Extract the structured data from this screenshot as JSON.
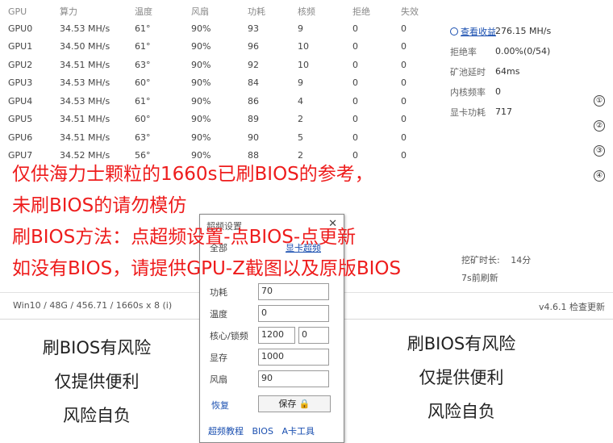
{
  "table": {
    "headers": [
      "GPU",
      "算力",
      "温度",
      "风扇",
      "功耗",
      "核频",
      "拒绝",
      "失效"
    ],
    "rows": [
      [
        "GPU0",
        "34.53 MH/s",
        "61°",
        "90%",
        "93",
        "9",
        "0",
        "0"
      ],
      [
        "GPU1",
        "34.50 MH/s",
        "61°",
        "90%",
        "96",
        "10",
        "0",
        "0"
      ],
      [
        "GPU2",
        "34.51 MH/s",
        "63°",
        "90%",
        "92",
        "10",
        "0",
        "0"
      ],
      [
        "GPU3",
        "34.53 MH/s",
        "60°",
        "90%",
        "84",
        "9",
        "0",
        "0"
      ],
      [
        "GPU4",
        "34.53 MH/s",
        "61°",
        "90%",
        "86",
        "4",
        "0",
        "0"
      ],
      [
        "GPU5",
        "34.51 MH/s",
        "60°",
        "90%",
        "89",
        "2",
        "0",
        "0"
      ],
      [
        "GPU6",
        "34.51 MH/s",
        "63°",
        "90%",
        "90",
        "5",
        "0",
        "0"
      ],
      [
        "GPU7",
        "34.52 MH/s",
        "56°",
        "90%",
        "88",
        "2",
        "0",
        "0"
      ]
    ]
  },
  "stats": {
    "view_earnings": "查看收益",
    "hashrate_total": "276.15 MH/s",
    "reject_label": "拒绝率",
    "reject_value": "0.00%(0/54)",
    "latency_label": "矿池延时",
    "latency_value": "64ms",
    "memory_label": "内核频率",
    "memory_value": "0",
    "power_label": "显卡功耗",
    "power_value": "717"
  },
  "side_numbers": [
    "①",
    "②",
    "③",
    "④"
  ],
  "runtime": {
    "label": "挖矿时长:",
    "value": "14分",
    "refresh": "7s前刷新"
  },
  "statusbar": {
    "left": "Win10  / 48G / 456.71 / 1660s x 8 (i)",
    "version": "v4.6.1",
    "update": "检查更新"
  },
  "overlay": {
    "line1": "仅供海力士颗粒的1660s已刷BIOS的参考，",
    "line2": "未刷BIOS的请勿模仿",
    "line3": "刷BIOS方法：点超频设置-点BIOS-点更新",
    "line4": "如没有BIOS，请提供GPU-Z截图以及原版BIOS"
  },
  "dialog": {
    "title": "超频设置",
    "close": "✕",
    "all_cards": "全部",
    "hint": "显卡超频",
    "power_label": "功耗",
    "power_value": "70",
    "temp_label": "温度",
    "temp_value": "0",
    "core_label": "核心/锁频",
    "core_value": "1200",
    "core_lock_value": "0",
    "mem_label": "显存",
    "mem_value": "1000",
    "fan_label": "风扇",
    "fan_value": "90",
    "restore": "恢复",
    "save": "保存",
    "links": [
      "超频教程",
      "BIOS",
      "A卡工具"
    ]
  },
  "warnings": {
    "line1": "刷BIOS有风险",
    "line2": "仅提供便利",
    "line3": "风险自负"
  }
}
